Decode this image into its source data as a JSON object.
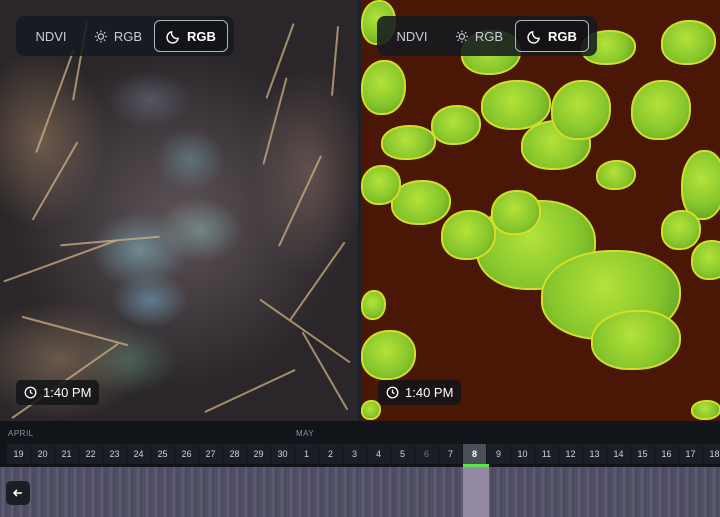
{
  "left_panel": {
    "modes": [
      {
        "label": "NDVI",
        "icon": "",
        "active": false
      },
      {
        "label": "RGB",
        "icon": "sun-icon",
        "active": false
      },
      {
        "label": "RGB",
        "icon": "moon-icon",
        "active": true
      }
    ],
    "time": "1:40 PM"
  },
  "right_panel": {
    "modes": [
      {
        "label": "NDVI",
        "icon": "",
        "active": false
      },
      {
        "label": "RGB",
        "icon": "sun-icon",
        "active": false
      },
      {
        "label": "RGB",
        "icon": "moon-icon",
        "active": true
      }
    ],
    "time": "1:40 PM"
  },
  "timeline": {
    "months": [
      {
        "label": "APRIL"
      },
      {
        "label": "MAY"
      }
    ],
    "days": [
      "19",
      "20",
      "21",
      "22",
      "23",
      "24",
      "25",
      "26",
      "27",
      "28",
      "29",
      "30",
      "1",
      "2",
      "3",
      "4",
      "5",
      "6",
      "7",
      "8",
      "9",
      "10",
      "11",
      "12",
      "13",
      "14",
      "15",
      "16",
      "17",
      "18"
    ],
    "dim_days": [
      "6"
    ],
    "selected_day": "8",
    "accent_color": "#5ee04f"
  }
}
